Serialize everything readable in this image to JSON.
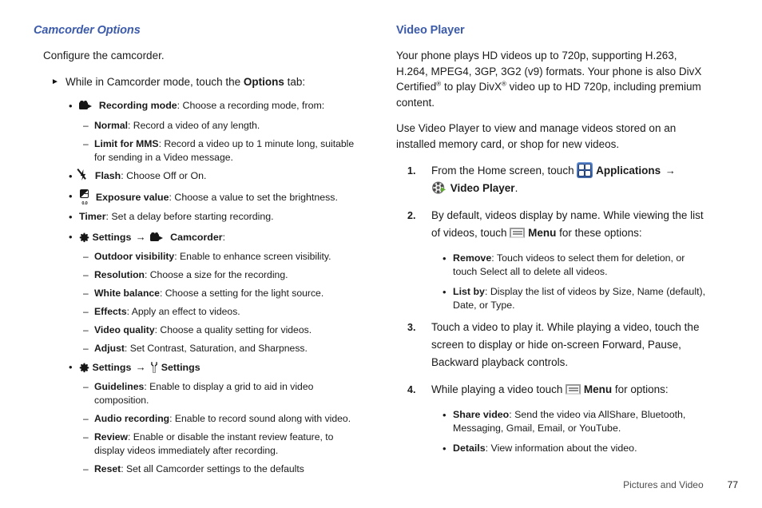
{
  "left": {
    "heading": "Camcorder Options",
    "intro": "Configure the camcorder.",
    "arrow_item": {
      "pre": "While in Camcorder mode, touch the ",
      "bold": "Options",
      "post": " tab:"
    },
    "items": [
      {
        "icon": "camcorder-icon",
        "term": "Recording mode",
        "desc": ": Choose a recording mode, from:",
        "subs": [
          {
            "term": "Normal",
            "desc": ": Record a video of any length."
          },
          {
            "term": "Limit for MMS",
            "desc": ": Record a video up to 1 minute long, suitable for sending in a Video message."
          }
        ]
      },
      {
        "icon": "flash-off-icon",
        "term": "Flash",
        "desc": ": Choose Off or On.",
        "subs": []
      },
      {
        "icon": "exposure-value-icon",
        "term": "Exposure value",
        "desc": ": Choose a value to set the brightness.",
        "subs": []
      },
      {
        "icon": null,
        "term": "Timer",
        "desc": ": Set a delay before starting recording.",
        "subs": []
      },
      {
        "icon": "gear-icon",
        "term": "Settings",
        "arrow": "→",
        "icon2": "camcorder-icon",
        "term2": "Camcorder",
        "desc": ":",
        "subs": [
          {
            "term": "Outdoor visibility",
            "desc": ": Enable to enhance screen visibility."
          },
          {
            "term": "Resolution",
            "desc": ": Choose a size for the recording."
          },
          {
            "term": "White balance",
            "desc": ": Choose a setting for the light source."
          },
          {
            "term": "Effects",
            "desc": ": Apply an effect to videos."
          },
          {
            "term": "Video quality",
            "desc": ": Choose a quality setting for videos."
          },
          {
            "term": "Adjust",
            "desc": ": Set Contrast, Saturation, and Sharpness."
          }
        ]
      },
      {
        "icon": "gear-icon",
        "term": "Settings",
        "arrow": "→",
        "icon2": "wrench-icon",
        "term2": "Settings",
        "desc": "",
        "subs": [
          {
            "term": "Guidelines",
            "desc": ": Enable to display a grid to aid in video composition."
          },
          {
            "term": "Audio recording",
            "desc": ": Enable to record sound along with video."
          },
          {
            "term": "Review",
            "desc": ": Enable or disable the instant review feature, to display videos immediately after recording."
          },
          {
            "term": "Reset",
            "desc": ": Set all Camcorder settings to the defaults"
          }
        ]
      }
    ]
  },
  "right": {
    "heading": "Video Player",
    "para1_a": "Your phone plays HD videos up to 720p, supporting H.263, H.264, MPEG4, 3GP, 3G2 (v9) formats. Your phone is also DivX Certified",
    "para1_b": " to play DivX",
    "para1_c": " video up to HD 720p, including premium content.",
    "reg_mark": "®",
    "para2": "Use Video Player to view and manage videos stored on an installed memory card, or shop for new videos.",
    "steps": [
      {
        "num": "1.",
        "text_a": "From the Home screen, touch ",
        "icon1": "applications-icon",
        "bold1": "Applications",
        "arrow": "→",
        "icon2": "video-player-icon",
        "bold2": "Video Player",
        "text_b": ".",
        "subs": []
      },
      {
        "num": "2.",
        "text_a": "By default, videos display by name. While viewing the list of videos, touch ",
        "icon1": "menu-key-icon",
        "bold1": "Menu",
        "text_b": " for these options:",
        "subs": [
          {
            "term": "Remove",
            "desc": ": Touch videos to select them for deletion, or touch Select all to delete all videos."
          },
          {
            "term": "List by",
            "desc": ": Display the list of videos by Size, Name (default), Date, or Type."
          }
        ]
      },
      {
        "num": "3.",
        "text_a": "Touch a video to play it. While playing a video, touch the screen to display or hide on-screen Forward, Pause, Backward playback controls.",
        "subs": []
      },
      {
        "num": "4.",
        "text_a": "While playing a video touch ",
        "icon1": "menu-key-icon",
        "bold1": "Menu",
        "text_b": " for options:",
        "subs": [
          {
            "term": "Share video",
            "desc": ": Send the video via AllShare, Bluetooth, Messaging, Gmail, Email, or YouTube."
          },
          {
            "term": "Details",
            "desc": ": View information about the video."
          }
        ]
      }
    ]
  },
  "footer": {
    "chapter": "Pictures and Video",
    "page": "77"
  },
  "colors": {
    "heading_blue": "#3c5bab",
    "body_text": "#1b1b1b",
    "footer_text": "#4c4c4c",
    "apps_icon_blue": "#2a5296"
  }
}
